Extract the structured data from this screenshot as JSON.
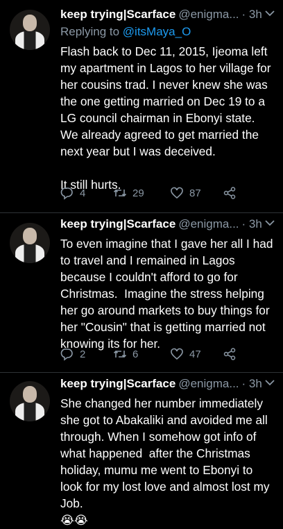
{
  "tweets": [
    {
      "name": "keep trying|Scarface",
      "handle": "@enigma...",
      "time": "· 3h",
      "reply_prefix": "Replying to",
      "reply_mention": "@itsMaya_O",
      "text": "Flash back to Dec 11, 2015, Ijeoma left my apartment in Lagos to her village for her cousins trad. I never knew she was the one getting married on Dec 19 to a LG council chairman in Ebonyi state. We already agreed to get married the next year but I was deceived.\n\nIt still hurts.",
      "replies": "4",
      "retweets": "29",
      "likes": "87"
    },
    {
      "name": "keep trying|Scarface",
      "handle": "@enigma...",
      "time": "· 3h",
      "text": "To even imagine that I gave her all I had to travel and I remained in Lagos because I couldn't afford to go for Christmas.  Imagine the stress helping her go around markets to buy things for her \"Cousin\" that is getting married not knowing its for her.",
      "replies": "2",
      "retweets": "6",
      "likes": "47"
    },
    {
      "name": "keep trying|Scarface",
      "handle": "@enigma...",
      "time": "· 3h",
      "text": "She changed her number immediately she got to Abakaliki and avoided me all through. When I somehow got info of what happened  after the Christmas holiday, mumu me went to Ebonyi to look for my lost love and almost lost my Job.",
      "emoji": "😭😭"
    }
  ],
  "icons": [
    "avatar",
    "caret-down-icon",
    "reply-icon",
    "retweet-icon",
    "like-icon",
    "share-icon"
  ],
  "colors": {
    "background": "#000000",
    "secondary": "#8b98a5",
    "link": "#1d9bf0"
  }
}
